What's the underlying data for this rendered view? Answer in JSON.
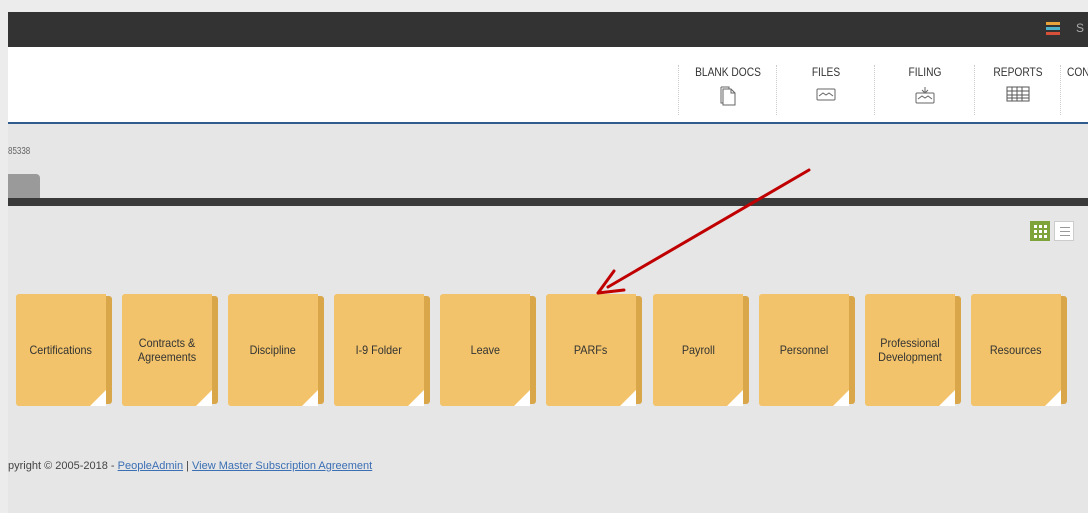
{
  "topbar": {
    "user_initial": "S"
  },
  "nav": [
    {
      "label": "BLANK DOCS",
      "icon": "document-icon"
    },
    {
      "label": "FILES",
      "icon": "inbox-icon"
    },
    {
      "label": "FILING",
      "icon": "filing-tray-icon"
    },
    {
      "label": "REPORTS",
      "icon": "table-report-icon"
    },
    {
      "label": "CON",
      "icon": ""
    }
  ],
  "record_id": "85338",
  "folders": [
    {
      "label": "Certifications"
    },
    {
      "label": "Contracts & Agreements"
    },
    {
      "label": "Discipline"
    },
    {
      "label": "I-9 Folder"
    },
    {
      "label": "Leave"
    },
    {
      "label": "PARFs"
    },
    {
      "label": "Payroll"
    },
    {
      "label": "Personnel"
    },
    {
      "label": "Professional Development"
    },
    {
      "label": "Resources"
    }
  ],
  "footer": {
    "copyright": "pyright © 2005-2018 - ",
    "link1": "PeopleAdmin",
    "sep": " | ",
    "link2": "View Master Subscription Agreement"
  },
  "colors": {
    "folder": "#f2c36a",
    "folder_tab": "#d9a64a",
    "annotation_arrow": "#c00000",
    "header_border": "#2f5b8e"
  }
}
